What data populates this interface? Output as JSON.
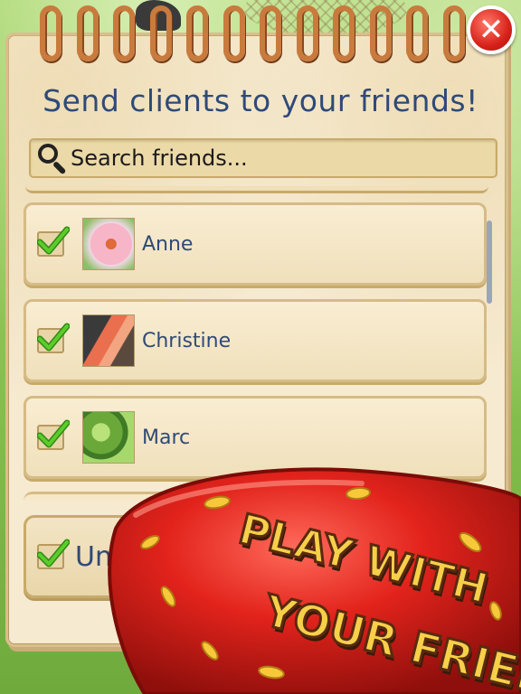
{
  "popup": {
    "title": "Send clients to your friends!",
    "close_icon": "close-icon",
    "close_symbol": "✕"
  },
  "search": {
    "placeholder": "Search friends...",
    "icon": "search-icon"
  },
  "friends": [
    {
      "name": "Anne",
      "checked": true,
      "avatar": "pink-daisy-photo"
    },
    {
      "name": "Christine",
      "checked": true,
      "avatar": "flamingo-photo"
    },
    {
      "name": "Marc",
      "checked": true,
      "avatar": "green-leaves-photo"
    }
  ],
  "footer": {
    "toggle_label": "Un",
    "checked": true
  },
  "promo": {
    "line1": "PLAY WITH",
    "line2": "YOUR FRIENDS!"
  },
  "colors": {
    "title_blue": "#2f4a78",
    "paper": "#f6ead0",
    "promo_yellow": "#f7d04a",
    "strawberry_red": "#d8221a",
    "check_green": "#3aa820"
  }
}
